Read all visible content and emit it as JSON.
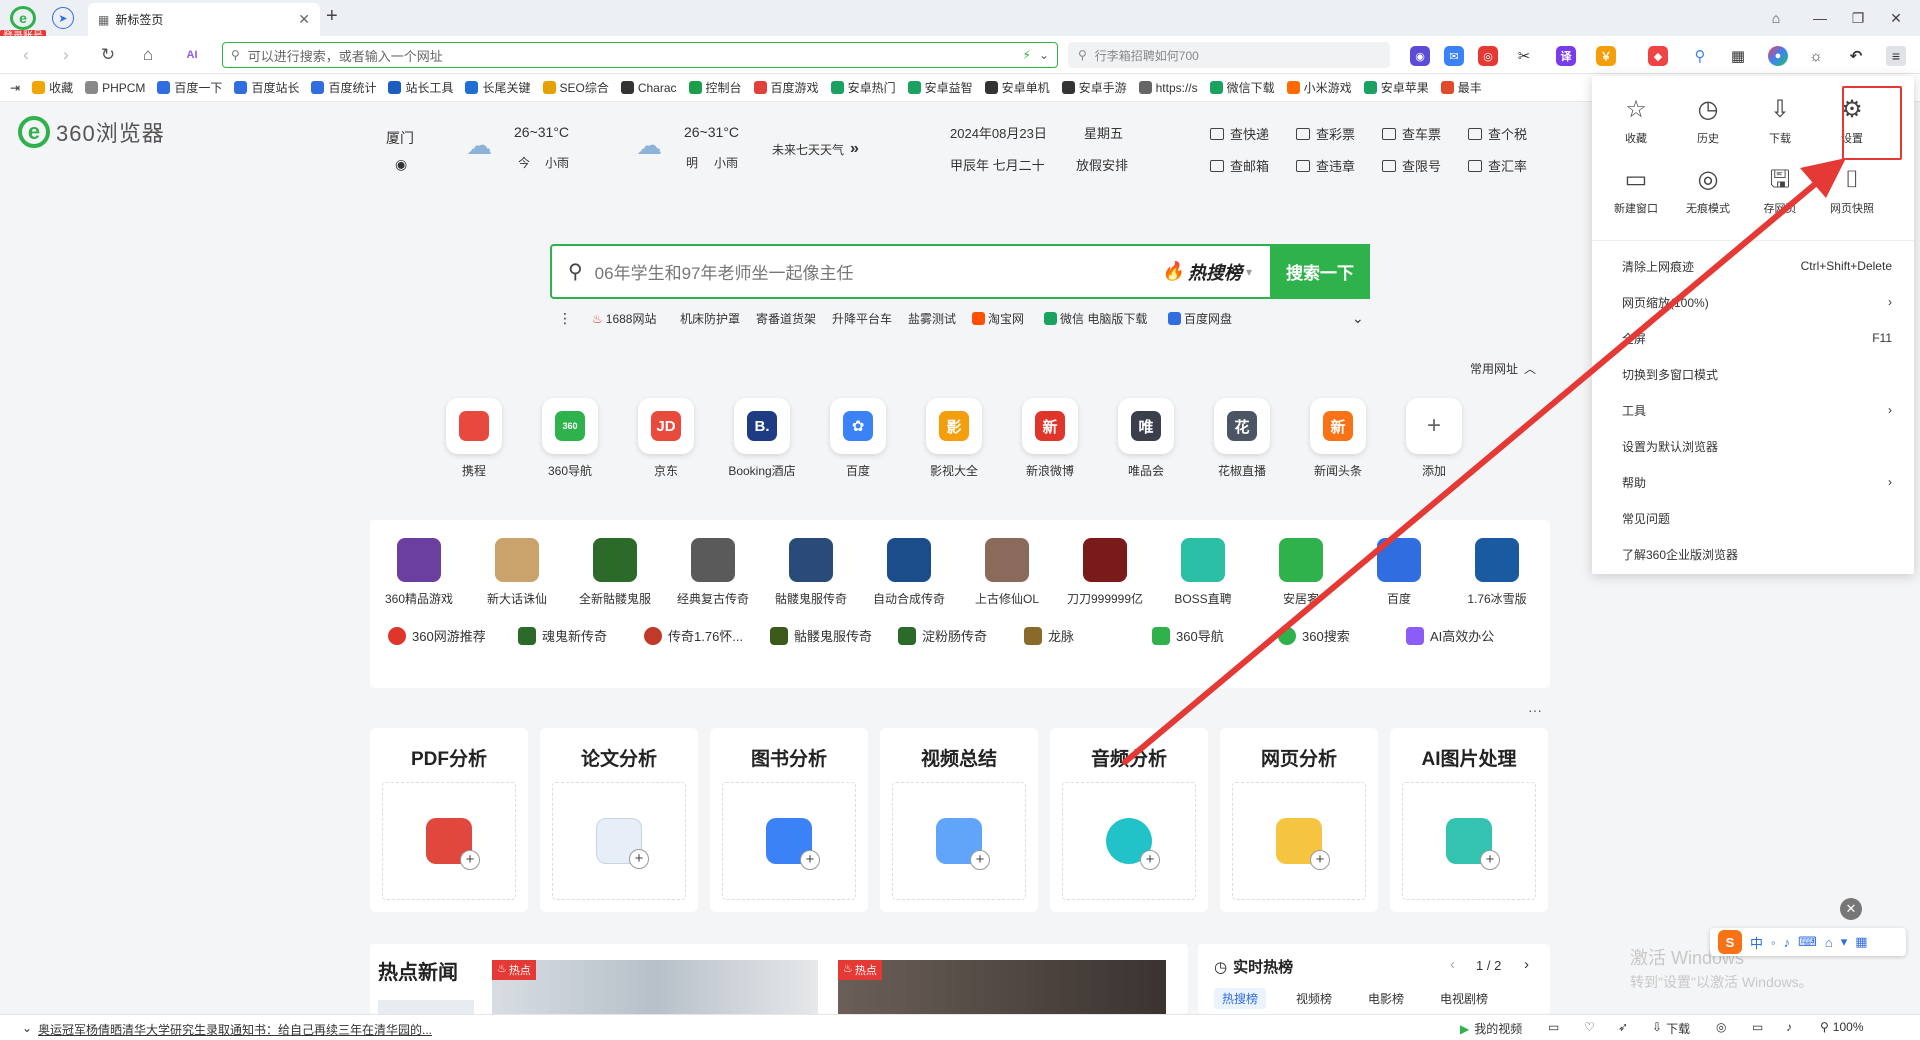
{
  "titlebar": {
    "login_badge": "登录账号",
    "tab_title": "新标签页",
    "new_tab": "+"
  },
  "navbar": {
    "address_placeholder": "可以进行搜索，或者输入一个网址",
    "search_placeholder": "行李箱招聘如何700"
  },
  "bookmarks": [
    {
      "label": "收藏",
      "color": "#f0a500"
    },
    {
      "label": "PHPCM",
      "color": "#888888"
    },
    {
      "label": "百度一下",
      "color": "#2f6de1"
    },
    {
      "label": "百度站长",
      "color": "#2f6de1"
    },
    {
      "label": "百度统计",
      "color": "#2f6de1"
    },
    {
      "label": "站长工具",
      "color": "#1a5fbf"
    },
    {
      "label": "长尾关键",
      "color": "#1f6ed4"
    },
    {
      "label": "SEO综合",
      "color": "#e4a100"
    },
    {
      "label": "Charac",
      "color": "#333333"
    },
    {
      "label": "控制台",
      "color": "#1c9e4a"
    },
    {
      "label": "百度游戏",
      "color": "#e0413a"
    },
    {
      "label": "安卓热门",
      "color": "#1aa260"
    },
    {
      "label": "安卓益智",
      "color": "#1aa260"
    },
    {
      "label": "安卓单机",
      "color": "#333333"
    },
    {
      "label": "安卓手游",
      "color": "#333333"
    },
    {
      "label": "https://s",
      "color": "#666666"
    },
    {
      "label": "微信下载",
      "color": "#1aa260"
    },
    {
      "label": "小米游戏",
      "color": "#ff6a00"
    },
    {
      "label": "安卓苹果",
      "color": "#1aa260"
    },
    {
      "label": "最丰",
      "color": "#e04b2c"
    }
  ],
  "weather": {
    "city": "厦门",
    "today_temp": "26~31°C",
    "today_label": "今",
    "today_desc": "小雨",
    "tomorrow_temp": "26~31°C",
    "tomorrow_label": "明",
    "tomorrow_desc": "小雨",
    "seven_day": "未来七天天气"
  },
  "date": {
    "date": "2024年08月23日",
    "weekday": "星期五",
    "lunar": "甲辰年 七月二十",
    "holiday": "放假安排"
  },
  "quick_links": [
    "查快递",
    "查彩票",
    "查车票",
    "查个税",
    "查邮箱",
    "查违章",
    "查限号",
    "查汇率"
  ],
  "search": {
    "placeholder": "06年学生和97年老师坐一起像主任",
    "hot_label": "热搜榜",
    "button": "搜索一下"
  },
  "hot_words": [
    "1688网站",
    "机床防护罩",
    "寄番道货架",
    "升降平台车",
    "盐雾测试",
    "淘宝网",
    "微信 电脑版下载",
    "百度网盘"
  ],
  "common_sites_label": "常用网址",
  "sites": [
    {
      "label": "携程",
      "glyph": "",
      "color": "#e8483e"
    },
    {
      "label": "360导航",
      "glyph": "360",
      "color": "#2fb24c"
    },
    {
      "label": "京东",
      "glyph": "JD",
      "color": "#e84a3c"
    },
    {
      "label": "Booking酒店",
      "glyph": "B.",
      "color": "#1d3c84"
    },
    {
      "label": "百度",
      "glyph": "✿",
      "color": "#3b82f6"
    },
    {
      "label": "影视大全",
      "glyph": "影",
      "color": "#f59e0b"
    },
    {
      "label": "新浪微博",
      "glyph": "新",
      "color": "#e0352b"
    },
    {
      "label": "唯品会",
      "glyph": "唯",
      "color": "#3a3f4b"
    },
    {
      "label": "花椒直播",
      "glyph": "花",
      "color": "#4b5563"
    },
    {
      "label": "新闻头条",
      "glyph": "新",
      "color": "#f97316"
    },
    {
      "label": "添加",
      "glyph": "+",
      "color": "#ffffff"
    }
  ],
  "games": [
    {
      "label": "360精品游戏",
      "color": "#6b3fa0"
    },
    {
      "label": "新大话诛仙",
      "color": "#c9a36b"
    },
    {
      "label": "全新骷髅鬼服",
      "color": "#2c6a2a"
    },
    {
      "label": "经典复古传奇",
      "color": "#5a5a5a"
    },
    {
      "label": "骷髅鬼服传奇",
      "color": "#2a4a7a"
    },
    {
      "label": "自动合成传奇",
      "color": "#1a4d8a"
    },
    {
      "label": "上古修仙OL",
      "color": "#8a6a5a"
    },
    {
      "label": "刀刀999999亿",
      "color": "#7a1a1a"
    },
    {
      "label": "BOSS直聘",
      "color": "#2bbfa5"
    },
    {
      "label": "安居客",
      "color": "#2fb24c"
    },
    {
      "label": "百度",
      "color": "#2f6de1"
    },
    {
      "label": "1.76冰雪版",
      "color": "#1a5aa0"
    }
  ],
  "game_row2": [
    {
      "label": "360网游推荐",
      "color": "#e0352b"
    },
    {
      "label": "魂鬼新传奇",
      "color": "#2c6a2a"
    },
    {
      "label": "传奇1.76怀...",
      "color": "#c0392b"
    },
    {
      "label": "骷髅鬼服传奇",
      "color": "#3c5a1a"
    },
    {
      "label": "淀粉肠传奇",
      "color": "#2c6a2a"
    },
    {
      "label": "龙脉",
      "color": "#8a6a2a"
    },
    {
      "label": "360导航",
      "color": "#2fb24c"
    },
    {
      "label": "360搜索",
      "color": "#2fb24c"
    },
    {
      "label": "AI高效办公",
      "color": "#8b5cf6"
    }
  ],
  "tools": [
    {
      "label": "PDF分析",
      "color": "#e0483e"
    },
    {
      "label": "论文分析",
      "color": "#e8eef8"
    },
    {
      "label": "图书分析",
      "color": "#3b82f6"
    },
    {
      "label": "视频总结",
      "color": "#60a5fa"
    },
    {
      "label": "音频分析",
      "color": "#22c3c8"
    },
    {
      "label": "网页分析",
      "color": "#f5c542"
    },
    {
      "label": "AI图片处理",
      "color": "#34c3b0"
    }
  ],
  "news": {
    "title": "热点新闻",
    "tag1": "热点",
    "tag2": "热点"
  },
  "hotlist": {
    "title": "实时热榜",
    "pager": "1 / 2",
    "tabs": [
      "热搜榜",
      "视频榜",
      "电影榜",
      "电视剧榜"
    ]
  },
  "watermark": {
    "line1": "激活 Windows",
    "line2": "转到\"设置\"以激活 Windows。"
  },
  "statusbar": {
    "headline": "奥运冠军杨倩晒清华大学研究生录取通知书：给自己再续三年在清华园的...",
    "video": "我的视频",
    "download": "下载",
    "zoom": "100%"
  },
  "menu": {
    "top": [
      {
        "label": "收藏",
        "icon": "star-icon",
        "glyph": "☆"
      },
      {
        "label": "历史",
        "icon": "clock-icon",
        "glyph": "◷"
      },
      {
        "label": "下载",
        "icon": "download-icon",
        "glyph": "⇩"
      },
      {
        "label": "设置",
        "icon": "gear-icon",
        "glyph": "⚙"
      },
      {
        "label": "新建窗口",
        "icon": "window-icon",
        "glyph": "▭"
      },
      {
        "label": "无痕模式",
        "icon": "incognito-icon",
        "glyph": "◎"
      },
      {
        "label": "存网页",
        "icon": "save-icon",
        "glyph": "🖫"
      },
      {
        "label": "网页快照",
        "icon": "camera-icon",
        "glyph": "⌷"
      }
    ],
    "items": [
      {
        "label": "清除上网痕迹",
        "shortcut": "Ctrl+Shift+Delete"
      },
      {
        "label": "网页缩放(100%)",
        "shortcut": "›"
      },
      {
        "label": "全屏",
        "shortcut": "F11"
      },
      {
        "label": "切换到多窗口模式",
        "shortcut": ""
      },
      {
        "label": "工具",
        "shortcut": "›"
      },
      {
        "label": "设置为默认浏览器",
        "shortcut": ""
      },
      {
        "label": "帮助",
        "shortcut": "›"
      },
      {
        "label": "常见问题",
        "shortcut": ""
      },
      {
        "label": "了解360企业版浏览器",
        "shortcut": ""
      }
    ]
  },
  "colors": {
    "accent": "#2fb24c",
    "highlight": "#e53935",
    "arrow": "#e53935"
  }
}
